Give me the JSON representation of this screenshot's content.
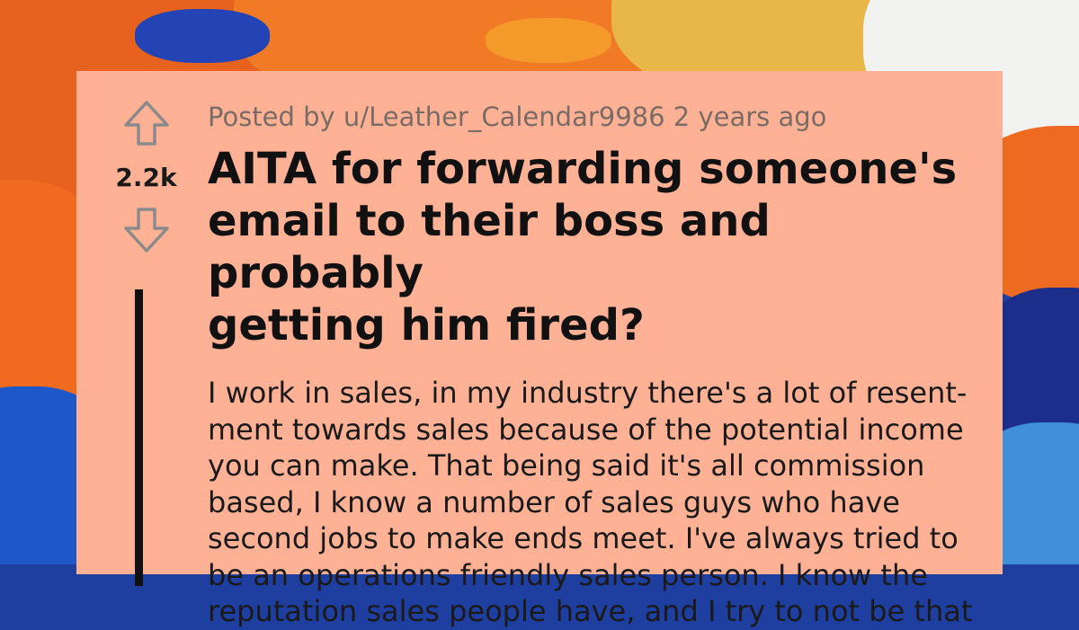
{
  "post": {
    "meta": "Posted by u/Leather_Calendar9986 2 years ago",
    "score": "2.2k",
    "title_lines": [
      "AITA for forwarding someone's",
      "email to their boss and probably",
      "getting him fired?"
    ],
    "body_lines": [
      "I work in sales, in my industry there's a lot of resent-",
      "ment towards sales because of the potential income",
      "you can make. That being said it's all commission",
      "based, I know a number of sales guys who have",
      "second jobs to make ends meet. I've always tried to",
      "be an operations friendly sales person. I know the",
      "reputation sales people have, and I try to not be that"
    ]
  },
  "icons": {
    "upvote": "upvote-arrow-icon",
    "downvote": "downvote-arrow-icon"
  },
  "colors": {
    "card": "#ffb195",
    "arrow": "#8a8a8a",
    "thread_line": "#111111"
  }
}
